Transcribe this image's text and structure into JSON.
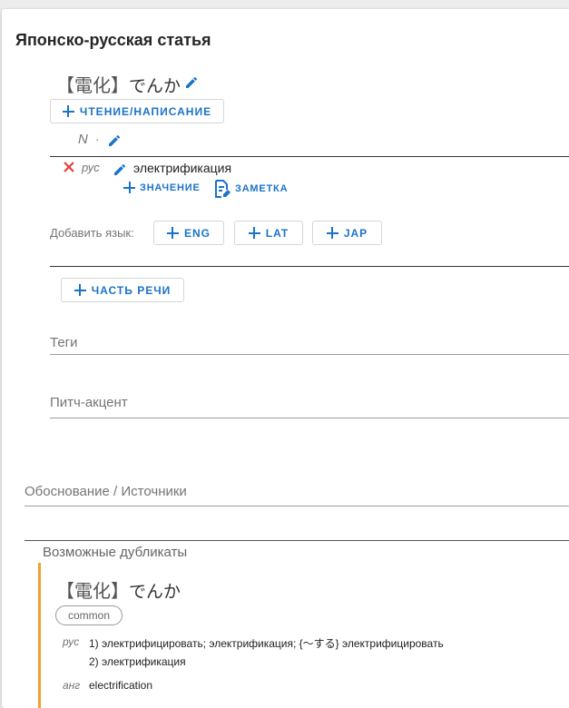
{
  "article": {
    "title": "Японско-русская статья",
    "kanji": "【電化】",
    "kana": "でんか",
    "add_reading_label": "ЧТЕНИЕ/НАПИСАНИЕ",
    "pos": "N",
    "pos_dot": "·"
  },
  "translation": {
    "lang": "рус",
    "text": "электрификация",
    "add_meaning_label": "ЗНАЧЕНИЕ",
    "note_label": "ЗАМЕТКА"
  },
  "add_language": {
    "label": "Добавить язык:",
    "buttons": [
      "ENG",
      "LAT",
      "JAP"
    ]
  },
  "add_pos_label": "ЧАСТЬ РЕЧИ",
  "fields": {
    "tags": "Теги",
    "pitch": "Питч-акцент",
    "sources": "Обоснование / Источники"
  },
  "duplicates": {
    "heading": "Возможные дубликаты",
    "kanji": "【電化】",
    "kana": "でんか",
    "chip": "common",
    "rus_lang": "рус",
    "rus_1": "1) электрифицировать; электрификация; {〜する} электрифицировать",
    "rus_2": "2) электрификация",
    "eng_lang": "анг",
    "eng_1": "electrification"
  },
  "colors": {
    "accent": "#1a73c8",
    "delete": "#e53935",
    "duplicate_bar": "#f0a030"
  },
  "icons": [
    "pencil-icon",
    "plus-icon",
    "close-icon",
    "note-icon"
  ]
}
